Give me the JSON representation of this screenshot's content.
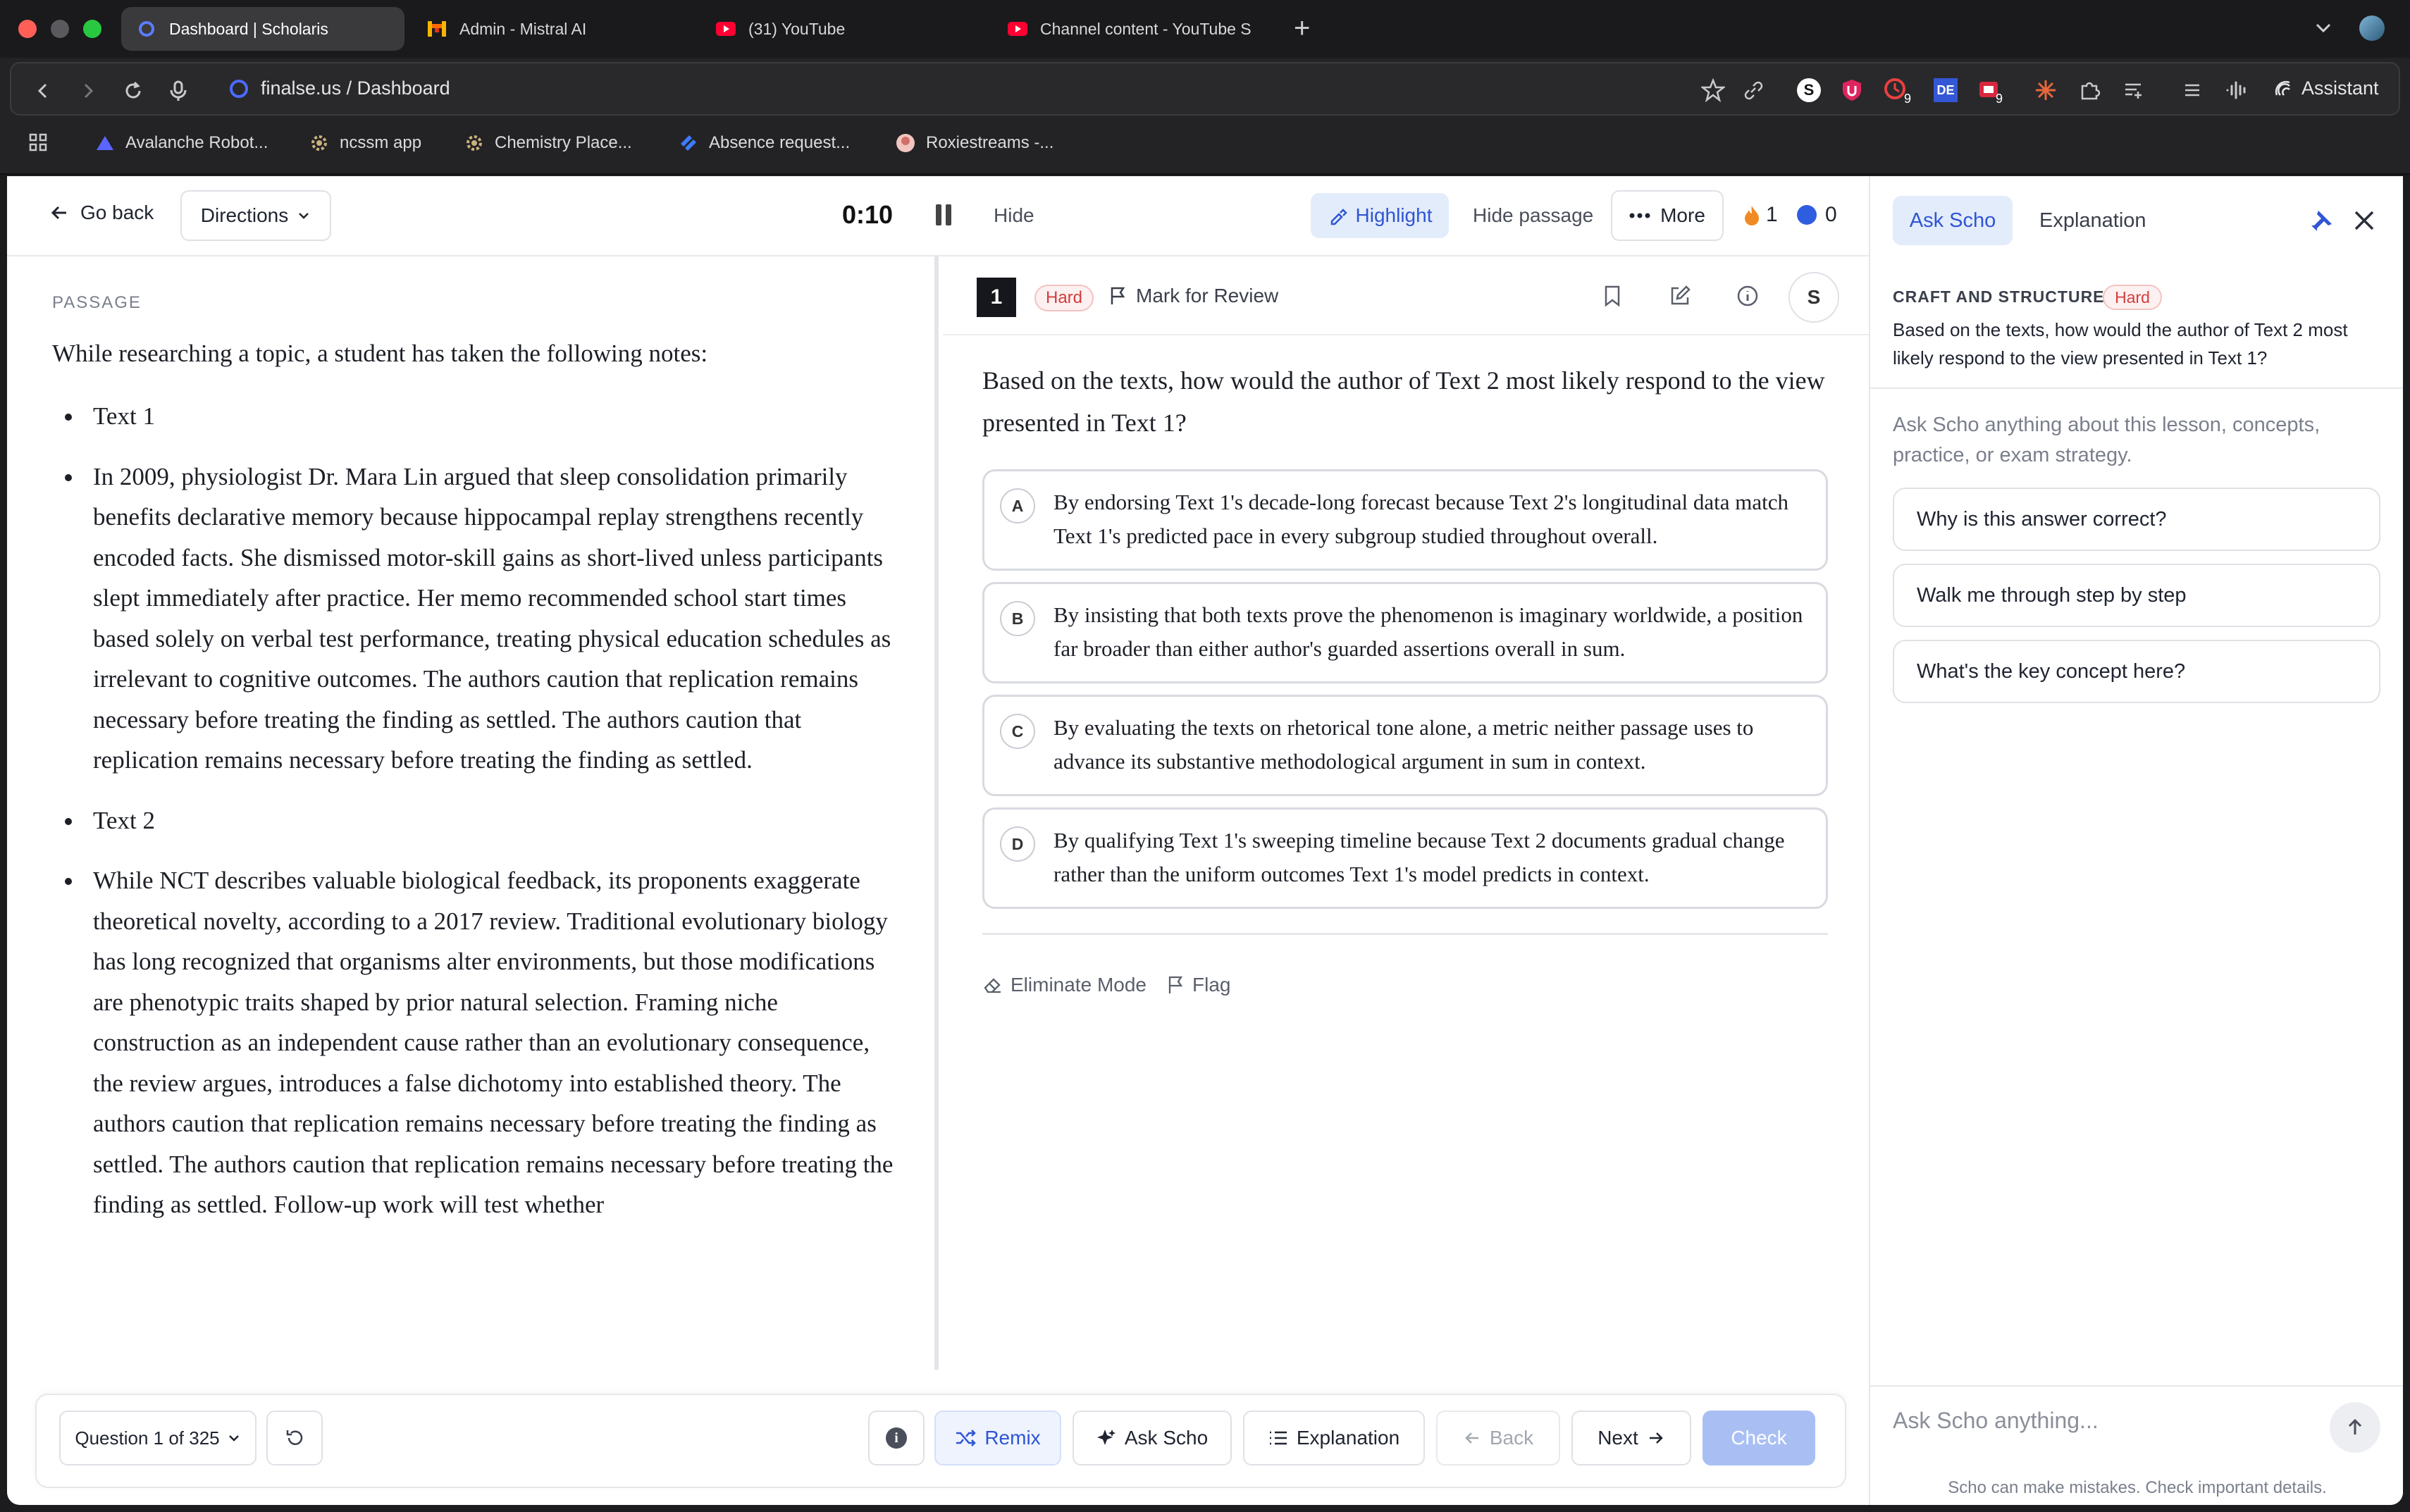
{
  "browser": {
    "tabs": [
      {
        "title": "Dashboard | Scholaris",
        "active": true
      },
      {
        "title": "Admin - Mistral AI",
        "active": false
      },
      {
        "title": "(31) YouTube",
        "active": false
      },
      {
        "title": "Channel content - YouTube S",
        "active": false
      }
    ],
    "url_domain": "finalse.us",
    "url_path": "/ Dashboard",
    "assistant_label": "Assistant",
    "ext_badge_1": "9",
    "ext_badge_2": "9",
    "ext_de": "DE",
    "ext_s": "S",
    "bookmarks": [
      {
        "label": "Avalanche Robot..."
      },
      {
        "label": "ncssm app"
      },
      {
        "label": "Chemistry Place..."
      },
      {
        "label": "Absence request..."
      },
      {
        "label": "Roxiestreams -..."
      }
    ]
  },
  "topbar": {
    "go_back": "Go back",
    "directions": "Directions",
    "timer": "0:10",
    "hide": "Hide",
    "highlight": "Highlight",
    "hide_passage": "Hide passage",
    "more": "More",
    "streak_count": "1",
    "points_count": "0"
  },
  "passage": {
    "label": "PASSAGE",
    "intro": "While researching a topic, a student has taken the following notes:",
    "items": [
      "Text 1",
      "In 2009, physiologist Dr. Mara Lin argued that sleep consolidation primarily benefits declarative memory because hippocampal replay strengthens recently encoded facts. She dismissed motor-skill gains as short-lived unless participants slept immediately after practice. Her memo recommended school start times based solely on verbal test performance, treating physical education schedules as irrelevant to cognitive outcomes. The authors caution that replication remains necessary before treating the finding as settled. The authors caution that replication remains necessary before treating the finding as settled.",
      "Text 2",
      "While NCT describes valuable biological feedback, its proponents exaggerate theoretical novelty, according to a 2017 review. Traditional evolutionary biology has long recognized that organisms alter environments, but those modifications are phenotypic traits shaped by prior natural selection. Framing niche construction as an independent cause rather than an evolutionary consequence, the review argues, introduces a false dichotomy into established theory. The authors caution that replication remains necessary before treating the finding as settled. The authors caution that replication remains necessary before treating the finding as settled. Follow-up work will test whether"
    ]
  },
  "question": {
    "number": "1",
    "difficulty": "Hard",
    "mark_for_review": "Mark for Review",
    "avatar": "S",
    "text": "Based on the texts, how would the author of Text 2 most likely respond to the view presented in Text 1?",
    "choices": [
      {
        "letter": "A",
        "text": "By endorsing Text 1's decade-long forecast because Text 2's longitudinal data match Text 1's predicted pace in every subgroup studied throughout overall."
      },
      {
        "letter": "B",
        "text": "By insisting that both texts prove the phenomenon is imaginary worldwide, a position far broader than either author's guarded assertions overall in sum."
      },
      {
        "letter": "C",
        "text": "By evaluating the texts on rhetorical tone alone, a metric neither passage uses to advance its substantive methodological argument in sum in context."
      },
      {
        "letter": "D",
        "text": "By qualifying Text 1's sweeping timeline because Text 2 documents gradual change rather than the uniform outcomes Text 1's model predicts in context."
      }
    ],
    "eliminate_mode": "Eliminate Mode",
    "flag": "Flag"
  },
  "bottombar": {
    "question_selector": "Question 1 of 325",
    "remix": "Remix",
    "ask_scho": "Ask Scho",
    "explanation": "Explanation",
    "back": "Back",
    "next": "Next",
    "check": "Check"
  },
  "assistant_panel": {
    "tab_ask": "Ask Scho",
    "tab_explanation": "Explanation",
    "section_label": "CRAFT AND STRUCTURE",
    "section_badge": "Hard",
    "section_question": "Based on the texts, how would the author of Text 2 most likely respond to the view presented in Text 1?",
    "intro": "Ask Scho anything about this lesson, concepts, practice, or exam strategy.",
    "suggestions": [
      "Why is this answer correct?",
      "Walk me through step by step",
      "What's the key concept here?"
    ],
    "input_placeholder": "Ask Scho anything...",
    "disclaimer": "Scho can make mistakes. Check important details."
  },
  "colors": {
    "accent": "#2f55d4",
    "accent_bg": "#e3ecfb",
    "hard_red": "#d43d3d",
    "check_disabled": "#a9bff4"
  }
}
